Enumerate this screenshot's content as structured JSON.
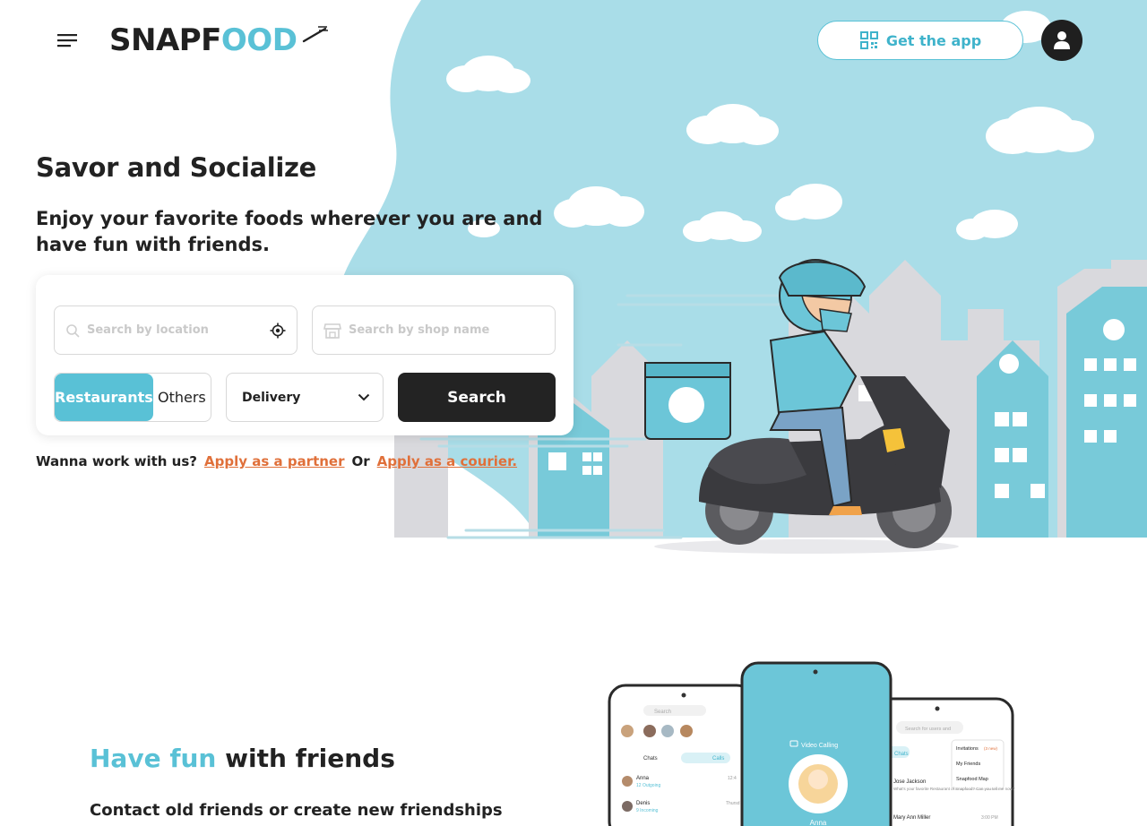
{
  "header": {
    "logo_text_dark": "SNAPF",
    "logo_text_accent": "OOD",
    "get_app_label": "Get the app"
  },
  "hero": {
    "title": "Savor and Socialize",
    "subtitle": "Enjoy your favorite foods wherever you are and have fun with friends."
  },
  "search": {
    "location_placeholder": "Search by location",
    "shop_placeholder": "Search by shop name",
    "toggle_active": "Restaurants",
    "toggle_inactive": "Others",
    "mode_selected": "Delivery",
    "search_label": "Search"
  },
  "work": {
    "prompt": "Wanna work with us?",
    "partner_link": "Apply as a partner",
    "or": "Or",
    "courier_link": "Apply as a courier."
  },
  "section2": {
    "title_accent": "Have fun",
    "title_rest": " with friends",
    "text": "Contact old friends or create new friendships with"
  },
  "phones": {
    "left_tab_chats": "Chats",
    "left_tab_calls": "Calls",
    "left_search": "Search",
    "left_rows": [
      {
        "name": "Anna",
        "sub": "12 Outgoing",
        "time": "12:4"
      },
      {
        "name": "Denis",
        "sub": "9 Incoming",
        "time": "Thursd"
      }
    ],
    "mid_label": "Video Calling",
    "mid_name": "Anna",
    "right_search": "Search for users and",
    "right_tab": "Chats",
    "right_menu": [
      "Invitations",
      "My Friends",
      "Snapfood Map"
    ],
    "right_menu_badge": "(3 new)",
    "right_rows": [
      {
        "name": "Jose Jackson",
        "msg": "What's your favorite Restaurant of Snapfood? Can you tell me now?"
      },
      {
        "name": "Mary Ann Miller",
        "msg": "",
        "time": "3:00 PM"
      }
    ]
  },
  "colors": {
    "accent": "#59c1d6",
    "link": "#e0703a",
    "dark": "#232323"
  }
}
